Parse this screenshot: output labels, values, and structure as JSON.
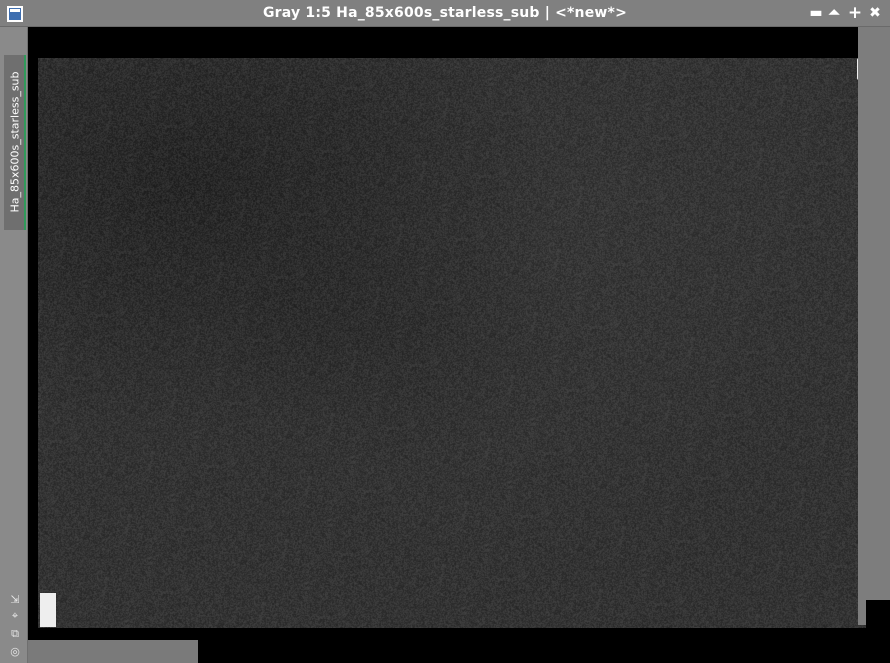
{
  "window": {
    "title": "Gray 1:5 Ha_85x600s_starless_sub | <*new*>",
    "controls": [
      "minimize-icon",
      "shade-icon",
      "maximize-icon",
      "close-icon"
    ],
    "control_glyphs": {
      "minimize": "▬",
      "shade": "⏶",
      "maximize": "+",
      "close": "✖"
    }
  },
  "sidebar": {
    "tab_label": "Ha_85x600s_starless_sub",
    "tools": [
      "zoom-fit-icon",
      "crosshair-icon",
      "clone-icon",
      "target-icon"
    ],
    "tool_glyphs": [
      "⇲",
      "⌖",
      "⧉",
      "◎"
    ]
  },
  "colors": {
    "accent": "#2f9a5a",
    "titlebar": "#808080",
    "image_base": "#3a3a3a"
  }
}
